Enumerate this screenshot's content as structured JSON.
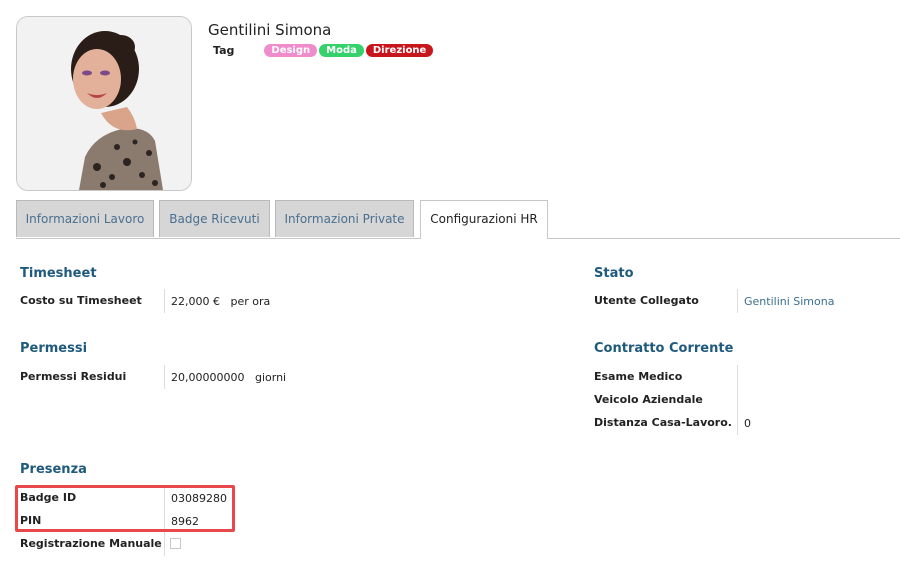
{
  "employee": {
    "name": "Gentilini Simona",
    "tag_label": "Tag",
    "tags": [
      {
        "label": "Design",
        "color": "#f08ccb"
      },
      {
        "label": "Moda",
        "color": "#35d16a"
      },
      {
        "label": "Direzione",
        "color": "#c8161d"
      }
    ]
  },
  "tabs": [
    {
      "label": "Informazioni Lavoro",
      "active": false
    },
    {
      "label": "Badge Ricevuti",
      "active": false
    },
    {
      "label": "Informazioni Private",
      "active": false
    },
    {
      "label": "Configurazioni HR",
      "active": true
    }
  ],
  "timesheet": {
    "title": "Timesheet",
    "cost_label": "Costo su Timesheet",
    "cost_value": "22,000 €",
    "cost_unit": "per ora"
  },
  "permessi": {
    "title": "Permessi",
    "remaining_label": "Permessi Residui",
    "remaining_value": "20,00000000",
    "remaining_unit": "giorni"
  },
  "presenza": {
    "title": "Presenza",
    "badge_label": "Badge ID",
    "badge_value": "03089280",
    "pin_label": "PIN",
    "pin_value": "8962",
    "manual_label": "Registrazione Manuale",
    "manual_checked": false
  },
  "stato": {
    "title": "Stato",
    "user_label": "Utente Collegato",
    "user_value": "Gentilini Simona"
  },
  "contratto": {
    "title": "Contratto Corrente",
    "medical_label": "Esame Medico",
    "medical_value": "",
    "vehicle_label": "Veicolo Aziendale",
    "vehicle_value": "",
    "distance_label": "Distanza Casa-Lavoro.",
    "distance_value": "0"
  },
  "colors": {
    "section_title": "#1f5a7d",
    "link": "#3b6e91",
    "highlight": "#e8474b"
  }
}
